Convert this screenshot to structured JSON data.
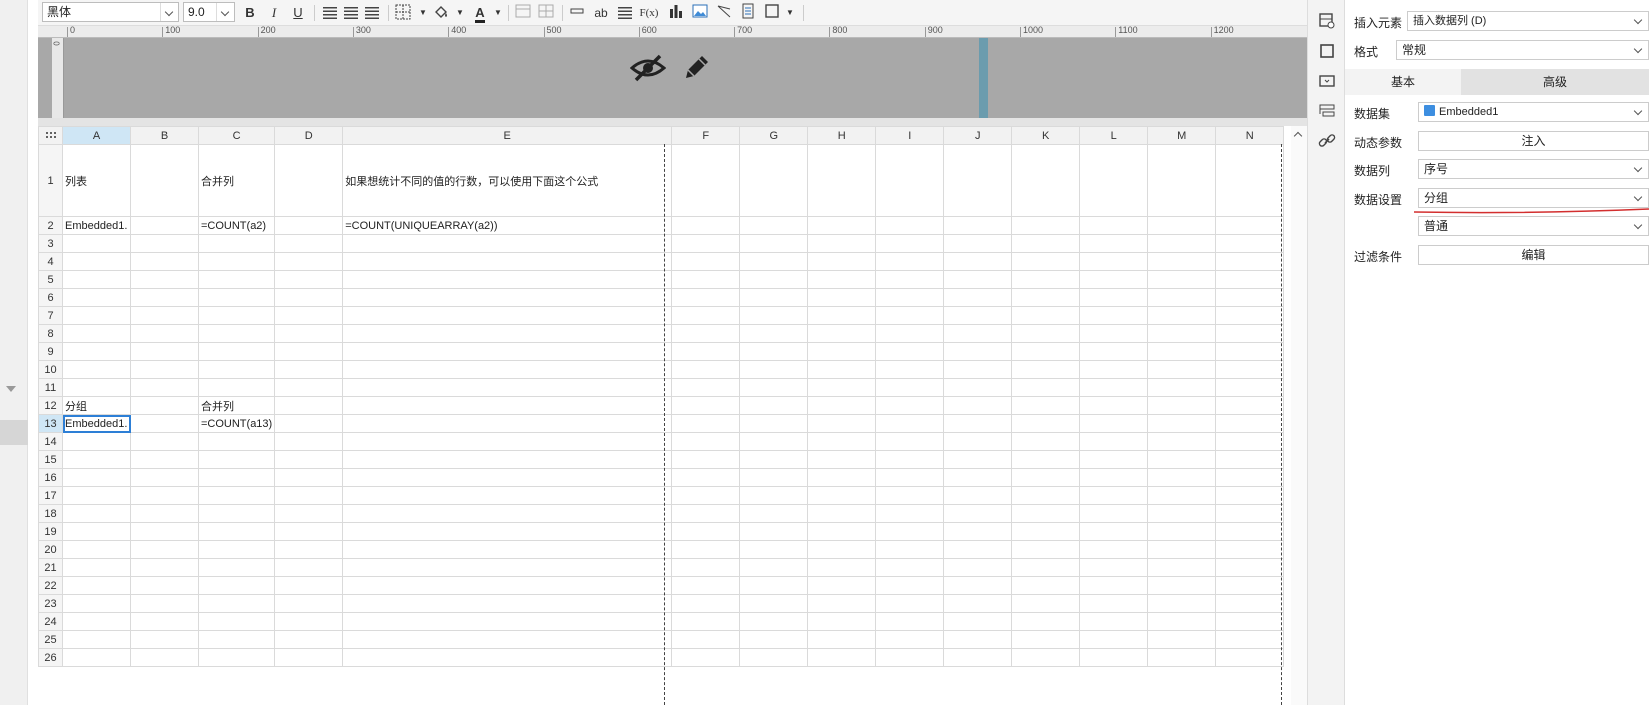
{
  "toolbar": {
    "font_family": "黑体",
    "font_size": "9.0",
    "bold": "B",
    "italic": "I",
    "underline": "U",
    "text_color_glyph": "A",
    "wrap_glyph": "ab",
    "formula_glyph": "F(x)"
  },
  "ruler": {
    "ticks": [
      "0",
      "100",
      "200",
      "300",
      "400",
      "500",
      "600",
      "700",
      "800",
      "900",
      "1000",
      "1100",
      "1200"
    ],
    "v_tick": "0"
  },
  "sheet": {
    "corner_icon": "grid-dots-icon",
    "columns": [
      "A",
      "B",
      "C",
      "D",
      "E",
      "F",
      "G",
      "H",
      "I",
      "J",
      "K",
      "L",
      "M",
      "N"
    ],
    "rows": [
      {
        "num": "1",
        "cells": {
          "A": "列表",
          "C": "合并列",
          "E": "如果想统计不同的值的行数，可以使用下面这个公式"
        }
      },
      {
        "num": "2",
        "cells": {
          "A": "Embedded1.",
          "C": "=COUNT(a2)",
          "E": "=COUNT(UNIQUEARRAY(a2))"
        }
      },
      {
        "num": "3",
        "cells": {}
      },
      {
        "num": "4",
        "cells": {}
      },
      {
        "num": "5",
        "cells": {}
      },
      {
        "num": "6",
        "cells": {}
      },
      {
        "num": "7",
        "cells": {}
      },
      {
        "num": "8",
        "cells": {}
      },
      {
        "num": "9",
        "cells": {}
      },
      {
        "num": "10",
        "cells": {}
      },
      {
        "num": "11",
        "cells": {}
      },
      {
        "num": "12",
        "cells": {
          "A": "分组",
          "C": "合并列"
        }
      },
      {
        "num": "13",
        "cells": {
          "A": "Embedded1.",
          "C": "=COUNT(a13)"
        }
      },
      {
        "num": "14",
        "cells": {}
      },
      {
        "num": "15",
        "cells": {}
      },
      {
        "num": "16",
        "cells": {}
      },
      {
        "num": "17",
        "cells": {}
      },
      {
        "num": "18",
        "cells": {}
      },
      {
        "num": "19",
        "cells": {}
      },
      {
        "num": "20",
        "cells": {}
      },
      {
        "num": "21",
        "cells": {}
      },
      {
        "num": "22",
        "cells": {}
      },
      {
        "num": "23",
        "cells": {}
      },
      {
        "num": "24",
        "cells": {}
      },
      {
        "num": "25",
        "cells": {}
      },
      {
        "num": "26",
        "cells": {}
      }
    ],
    "selected_cell": "A13"
  },
  "panel": {
    "insert_element_label": "插入元素",
    "insert_element_value": "插入数据列 (D)",
    "format_label": "格式",
    "format_value": "常规",
    "tab_basic": "基本",
    "tab_advanced": "高级",
    "dataset_label": "数据集",
    "dataset_value": "Embedded1",
    "dynamic_param_label": "动态参数",
    "dynamic_param_button": "注入",
    "data_column_label": "数据列",
    "data_column_value": "序号",
    "data_setting_label": "数据设置",
    "data_setting_value": "分组",
    "data_setting_mode": "普通",
    "filter_label": "过滤条件",
    "filter_button": "编辑"
  },
  "colors": {
    "selection": "#2d7fd6",
    "header_area": "#a8a8a8",
    "annotation": "#d32f2f"
  }
}
